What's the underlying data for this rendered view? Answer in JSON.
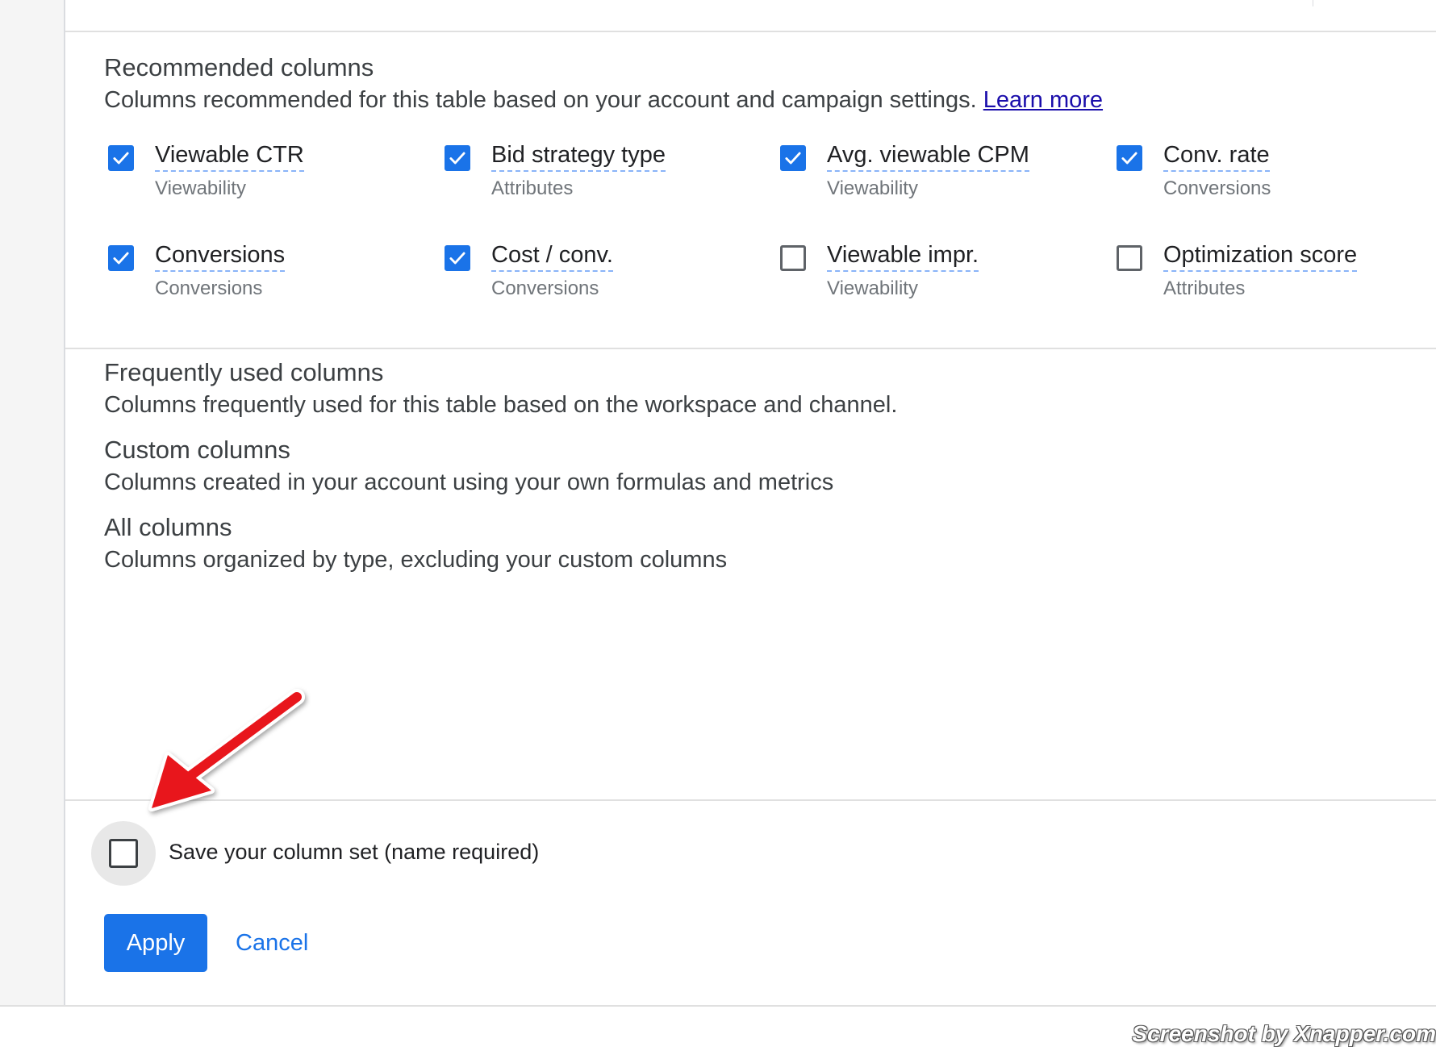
{
  "recommended": {
    "title": "Recommended columns",
    "description": "Columns recommended for this table based on your account and campaign settings.",
    "learn_more": "Learn more",
    "columns": [
      {
        "name": "Viewable CTR",
        "category": "Viewability",
        "checked": true
      },
      {
        "name": "Bid strategy type",
        "category": "Attributes",
        "checked": true
      },
      {
        "name": "Avg. viewable CPM",
        "category": "Viewability",
        "checked": true
      },
      {
        "name": "Conv. rate",
        "category": "Conversions",
        "checked": true
      },
      {
        "name": "Conversions",
        "category": "Conversions",
        "checked": true
      },
      {
        "name": "Cost / conv.",
        "category": "Conversions",
        "checked": true
      },
      {
        "name": "Viewable impr.",
        "category": "Viewability",
        "checked": false
      },
      {
        "name": "Optimization score",
        "category": "Attributes",
        "checked": false
      }
    ]
  },
  "frequent": {
    "title": "Frequently used columns",
    "description": "Columns frequently used for this table based on the workspace and channel."
  },
  "custom": {
    "title": "Custom columns",
    "description": "Columns created in your account using your own formulas and metrics"
  },
  "all": {
    "title": "All columns",
    "description": "Columns organized by type, excluding your custom columns"
  },
  "footer": {
    "save_label": "Save your column set (name required)",
    "save_checked": false,
    "apply_label": "Apply",
    "cancel_label": "Cancel"
  },
  "watermark": "Screenshot by Xnapper.com",
  "colors": {
    "accent": "#1a73e8",
    "link": "#1a0dab",
    "annotation_arrow": "#e8141b"
  }
}
